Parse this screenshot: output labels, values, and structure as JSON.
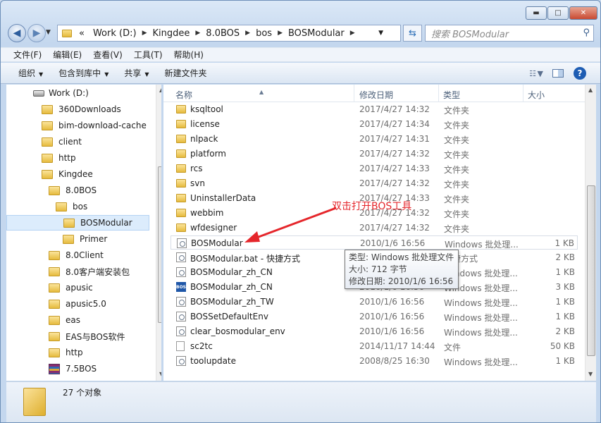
{
  "titlebar": {
    "min": "▬",
    "max": "□",
    "close": "✕"
  },
  "address": {
    "crumbs": [
      "«",
      "Work (D:)",
      "Kingdee",
      "8.0BOS",
      "bos",
      "BOSModular"
    ],
    "search_placeholder": "搜索 BOSModular"
  },
  "menu": [
    "文件(F)",
    "编辑(E)",
    "查看(V)",
    "工具(T)",
    "帮助(H)"
  ],
  "toolbar": {
    "organize": "组织",
    "include": "包含到库中",
    "share": "共享",
    "new_folder": "新建文件夹"
  },
  "nav": [
    {
      "label": "Work (D:)",
      "icon": "drive-icon",
      "indent": 0
    },
    {
      "label": "360Downloads",
      "icon": "folder-icon",
      "indent": 1
    },
    {
      "label": "bim-download-cache",
      "icon": "folder-icon",
      "indent": 1
    },
    {
      "label": "client",
      "icon": "folder-icon",
      "indent": 1
    },
    {
      "label": "http",
      "icon": "folder-icon",
      "indent": 1
    },
    {
      "label": "Kingdee",
      "icon": "folder-icon",
      "indent": 1
    },
    {
      "label": "8.0BOS",
      "icon": "folder-icon",
      "indent": 2
    },
    {
      "label": "bos",
      "icon": "folder-icon",
      "indent": 3
    },
    {
      "label": "BOSModular",
      "icon": "folder-icon",
      "indent": 4,
      "selected": true
    },
    {
      "label": "Primer",
      "icon": "folder-icon",
      "indent": 4
    },
    {
      "label": "8.0Client",
      "icon": "folder-icon",
      "indent": 2
    },
    {
      "label": "8.0客户端安装包",
      "icon": "folder-icon",
      "indent": 2
    },
    {
      "label": "apusic",
      "icon": "folder-icon",
      "indent": 2
    },
    {
      "label": "apusic5.0",
      "icon": "folder-icon",
      "indent": 2
    },
    {
      "label": "eas",
      "icon": "folder-icon",
      "indent": 2
    },
    {
      "label": "EAS与BOS软件",
      "icon": "folder-icon",
      "indent": 2
    },
    {
      "label": "http",
      "icon": "folder-icon",
      "indent": 2
    },
    {
      "label": "7.5BOS",
      "icon": "archive-icon",
      "indent": 2
    }
  ],
  "columns": {
    "name": "名称",
    "date": "修改日期",
    "type": "类型",
    "size": "大小"
  },
  "files": [
    {
      "name": "ksqltool",
      "date": "2017/4/27 14:32",
      "type": "文件夹",
      "size": "",
      "icon": "folder"
    },
    {
      "name": "license",
      "date": "2017/4/27 14:34",
      "type": "文件夹",
      "size": "",
      "icon": "folder"
    },
    {
      "name": "nlpack",
      "date": "2017/4/27 14:31",
      "type": "文件夹",
      "size": "",
      "icon": "folder"
    },
    {
      "name": "platform",
      "date": "2017/4/27 14:32",
      "type": "文件夹",
      "size": "",
      "icon": "folder"
    },
    {
      "name": "rcs",
      "date": "2017/4/27 14:33",
      "type": "文件夹",
      "size": "",
      "icon": "folder"
    },
    {
      "name": "svn",
      "date": "2017/4/27 14:32",
      "type": "文件夹",
      "size": "",
      "icon": "folder"
    },
    {
      "name": "UninstallerData",
      "date": "2017/4/27 14:33",
      "type": "文件夹",
      "size": "",
      "icon": "folder"
    },
    {
      "name": "webbim",
      "date": "2017/4/27 14:32",
      "type": "文件夹",
      "size": "",
      "icon": "folder"
    },
    {
      "name": "wfdesigner",
      "date": "2017/4/27 14:32",
      "type": "文件夹",
      "size": "",
      "icon": "folder"
    },
    {
      "name": "BOSModular",
      "date": "2010/1/6 16:56",
      "type": "Windows 批处理...",
      "size": "1 KB",
      "icon": "bat",
      "selected": true
    },
    {
      "name": "BOSModular.bat - 快捷方式",
      "date": "2010/1/6 16:56",
      "type": "快捷方式",
      "size": "2 KB",
      "icon": "bat"
    },
    {
      "name": "BOSModular_zh_CN",
      "date": "2010/1/6 16:56",
      "type": "Windows 批处理...",
      "size": "1 KB",
      "icon": "bat"
    },
    {
      "name": "BOSModular_zh_CN",
      "date": "2010/1/6 16:56",
      "type": "Windows 批处理...",
      "size": "3 KB",
      "icon": "bos"
    },
    {
      "name": "BOSModular_zh_TW",
      "date": "2010/1/6 16:56",
      "type": "Windows 批处理...",
      "size": "1 KB",
      "icon": "bat"
    },
    {
      "name": "BOSSetDefaultEnv",
      "date": "2010/1/6 16:56",
      "type": "Windows 批处理...",
      "size": "1 KB",
      "icon": "bat"
    },
    {
      "name": "clear_bosmodular_env",
      "date": "2010/1/6 16:56",
      "type": "Windows 批处理...",
      "size": "2 KB",
      "icon": "bat"
    },
    {
      "name": "sc2tc",
      "date": "2014/11/17 14:44",
      "type": "文件",
      "size": "50 KB",
      "icon": "file"
    },
    {
      "name": "toolupdate",
      "date": "2008/8/25 16:30",
      "type": "Windows 批处理...",
      "size": "1 KB",
      "icon": "bat"
    }
  ],
  "tooltip": {
    "type": "类型: Windows 批处理文件",
    "size": "大小: 712 字节",
    "modified": "修改日期: 2010/1/6 16:56"
  },
  "annotation": "双击打开BOS工具",
  "status": "27 个对象"
}
